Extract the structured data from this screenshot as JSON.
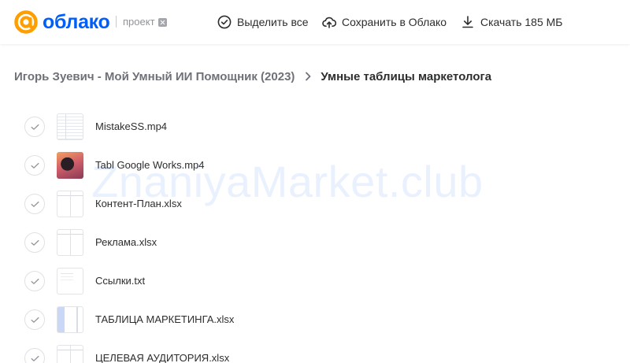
{
  "brand": {
    "logo_text": "облако",
    "project_label": "проект"
  },
  "toolbar": {
    "select_all": "Выделить все",
    "save_to_cloud": "Сохранить в Облако",
    "download": "Скачать 185 МБ"
  },
  "breadcrumb": {
    "parent": "Игорь Зуевич - Мой Умный ИИ Помощник (2023)",
    "current": "Умные таблицы маркетолога"
  },
  "files": [
    {
      "name": "MistakeSS.mp4",
      "thumb": "sheet"
    },
    {
      "name": "Tabl Google Works.mp4",
      "thumb": "video"
    },
    {
      "name": "Контент-План.xlsx",
      "thumb": "xls"
    },
    {
      "name": "Реклама.xlsx",
      "thumb": "xls"
    },
    {
      "name": "Ссылки.txt",
      "thumb": "doc"
    },
    {
      "name": "ТАБЛИЦА МАРКЕТИНГА.xlsx",
      "thumb": "blue"
    },
    {
      "name": "ЦЕЛЕВАЯ АУДИТОРИЯ.xlsx",
      "thumb": "xls"
    }
  ],
  "watermark": "ZnaniyaMarket.club",
  "colors": {
    "brand_blue": "#005ff9",
    "logo_orange": "#ff9e00",
    "text": "#2c2d2e",
    "muted": "#6f7178"
  }
}
